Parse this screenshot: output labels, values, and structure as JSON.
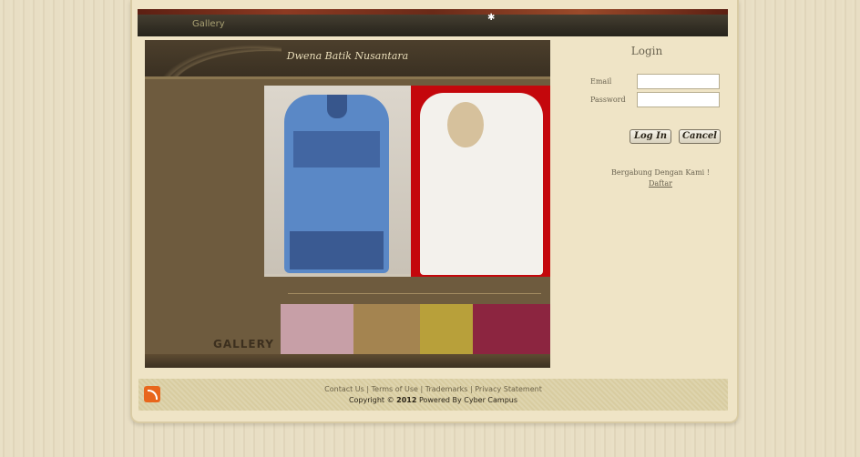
{
  "nav": {
    "gallery_label": "Gallery"
  },
  "header": {
    "site_title": "Dwena Batik Nusantara"
  },
  "gallery": {
    "label": "GALLERY"
  },
  "login": {
    "title": "Login",
    "email_label": "Email",
    "password_label": "Password",
    "email_value": "",
    "password_value": "",
    "login_button": "Log In",
    "cancel_button": "Cancel",
    "join_text": "Bergabung Dengan Kami !",
    "register_link": "Daftar"
  },
  "footer": {
    "contact": "Contact Us",
    "terms": "Terms of Use",
    "trademarks": "Trademarks",
    "privacy": "Privacy Statement",
    "copyright_prefix": "Copyright ©",
    "year": "2012",
    "powered": "Powered By Cyber Campus"
  },
  "colors": {
    "content_bg": "#6e5b3e",
    "accent_red": "#c4070c",
    "rss": "#e8661c"
  }
}
